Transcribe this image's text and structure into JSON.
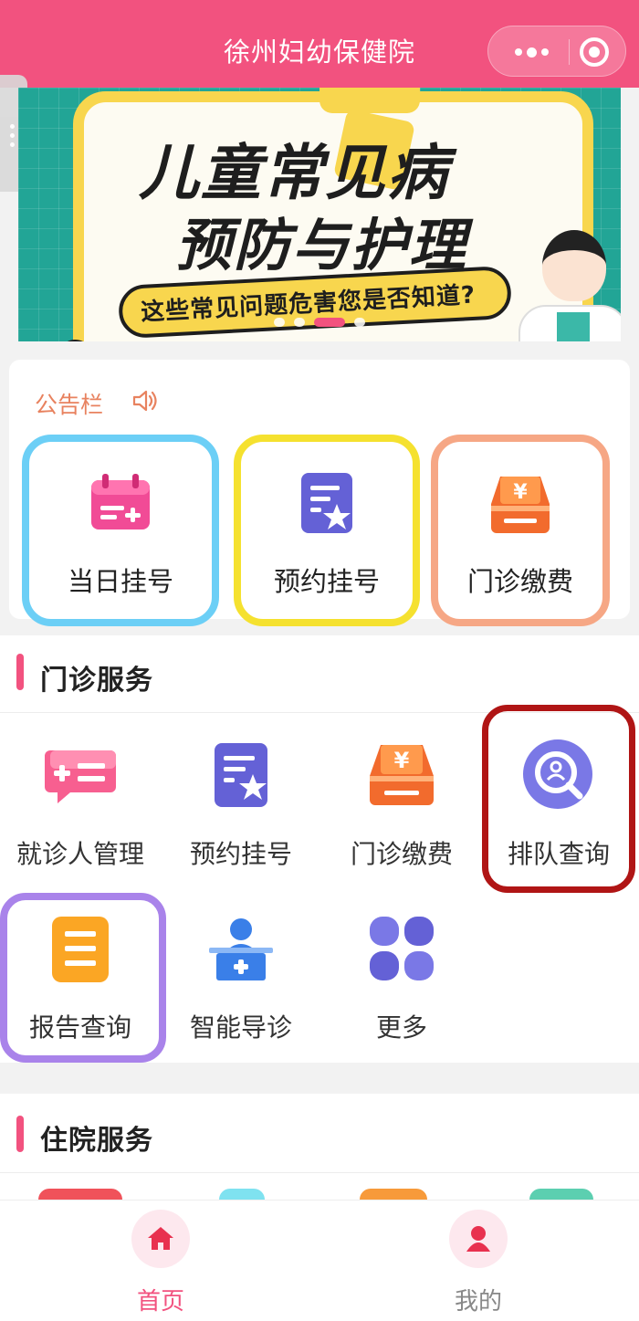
{
  "header": {
    "title": "徐州妇幼保健院"
  },
  "banner": {
    "line1": "儿童常见病",
    "line2": "预防与护理",
    "subtitle": "这些常见问题危害您是否知道?",
    "slide_count": 4,
    "active_slide": 3
  },
  "notice": {
    "title": "公告栏"
  },
  "quick_actions": [
    {
      "label": "当日挂号",
      "icon": "calendar-plus-icon"
    },
    {
      "label": "预约挂号",
      "icon": "doc-star-icon"
    },
    {
      "label": "门诊缴费",
      "icon": "yuan-tray-icon"
    }
  ],
  "outpatient": {
    "title": "门诊服务",
    "items": [
      {
        "label": "就诊人管理",
        "icon": "chat-plus-icon"
      },
      {
        "label": "预约挂号",
        "icon": "doc-star-icon"
      },
      {
        "label": "门诊缴费",
        "icon": "yuan-tray-icon"
      },
      {
        "label": "排队查询",
        "icon": "queue-search-icon"
      },
      {
        "label": "报告查询",
        "icon": "report-doc-icon"
      },
      {
        "label": "智能导诊",
        "icon": "guide-desk-icon"
      },
      {
        "label": "更多",
        "icon": "more-clover-icon"
      }
    ]
  },
  "inpatient": {
    "title": "住院服务"
  },
  "tabbar": {
    "home": "首页",
    "mine": "我的"
  },
  "colors": {
    "primary": "#f2527f",
    "notice": "#e8825f",
    "highlight_blue": "#6ccff6",
    "highlight_yellow": "#f5e12f",
    "highlight_orange": "#f6a785",
    "highlight_red": "#b01515",
    "highlight_purple": "#a983ea"
  }
}
